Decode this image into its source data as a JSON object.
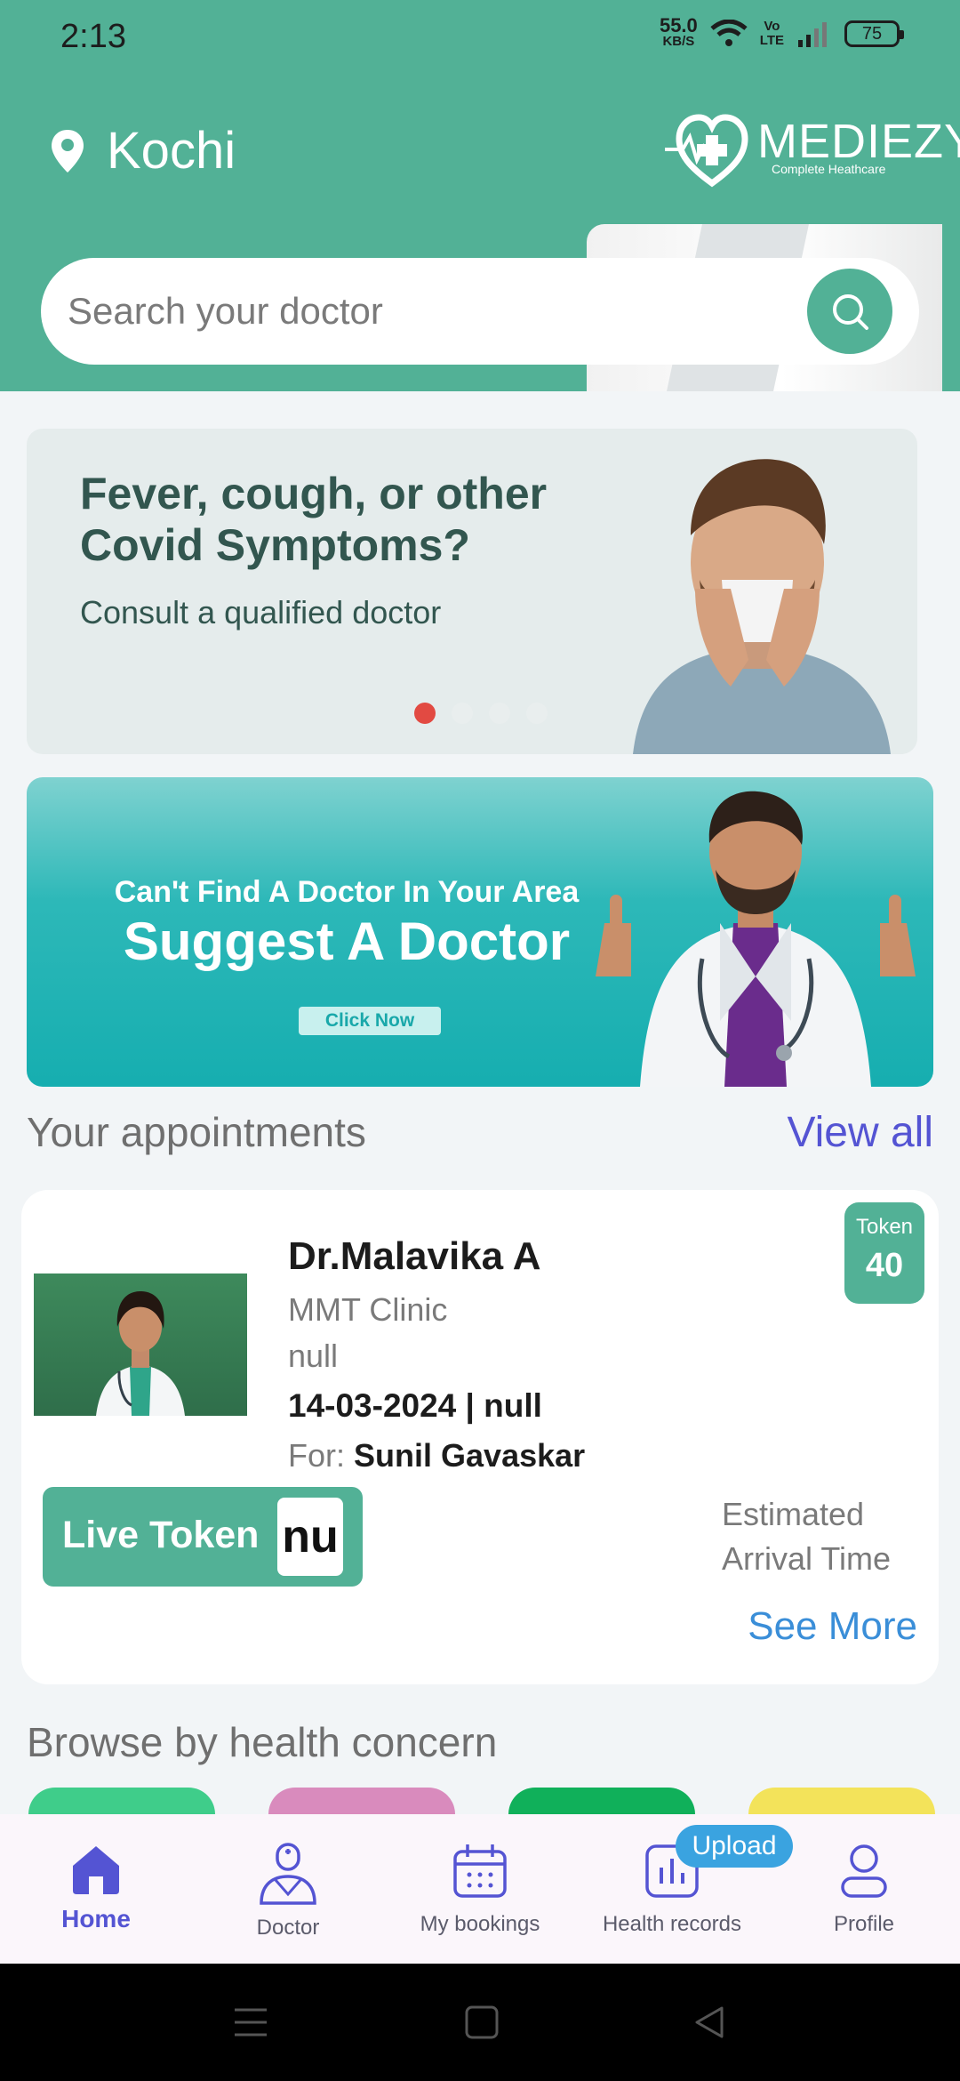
{
  "status_bar": {
    "time": "2:13",
    "net_speed": "55.0",
    "net_unit": "KB/S",
    "volte_top": "Vo",
    "volte_bottom": "LTE",
    "battery": "75"
  },
  "header": {
    "location": "Kochi",
    "logo_name": "MEDIEZY",
    "logo_tagline": "Complete Heathcare"
  },
  "search": {
    "placeholder": "Search your doctor"
  },
  "carousel": {
    "title": "Fever, cough, or other Covid Symptoms?",
    "subtitle": "Consult a qualified doctor",
    "active_slide": 1,
    "slide_count": 4
  },
  "suggest_banner": {
    "line1": "Can't Find A Doctor In Your Area",
    "line2": "Suggest A Doctor",
    "button": "Click Now"
  },
  "appointments": {
    "section_title": "Your appointments",
    "view_all": "View all",
    "card": {
      "doctor_name": "Dr.Malavika A",
      "clinic": "MMT Clinic",
      "line3": "null",
      "date_line": "14-03-2024 | null",
      "for_label": "For:",
      "for_name": "Sunil Gavaskar",
      "token_label": "Token",
      "token_number": "40",
      "live_token_label": "Live Token",
      "live_token_value": "nu",
      "eta_line1": "Estimated",
      "eta_line2": "Arrival Time",
      "see_more": "See More"
    }
  },
  "browse": {
    "title": "Browse by health concern",
    "card_colors": [
      "#3fcd8a",
      "#d98bbd",
      "#10b05a",
      "#f3e35a"
    ]
  },
  "bottom_nav": {
    "items": [
      {
        "label": "Home",
        "icon": "home-icon",
        "active": true
      },
      {
        "label": "Doctor",
        "icon": "doctor-icon"
      },
      {
        "label": "My bookings",
        "icon": "calendar-icon"
      },
      {
        "label": "Health records",
        "icon": "chart-icon"
      },
      {
        "label": "Profile",
        "icon": "person-icon"
      }
    ],
    "upload_badge": "Upload"
  },
  "colors": {
    "primary": "#52b196",
    "accent": "#5454d3",
    "link": "#3a8ed8"
  }
}
